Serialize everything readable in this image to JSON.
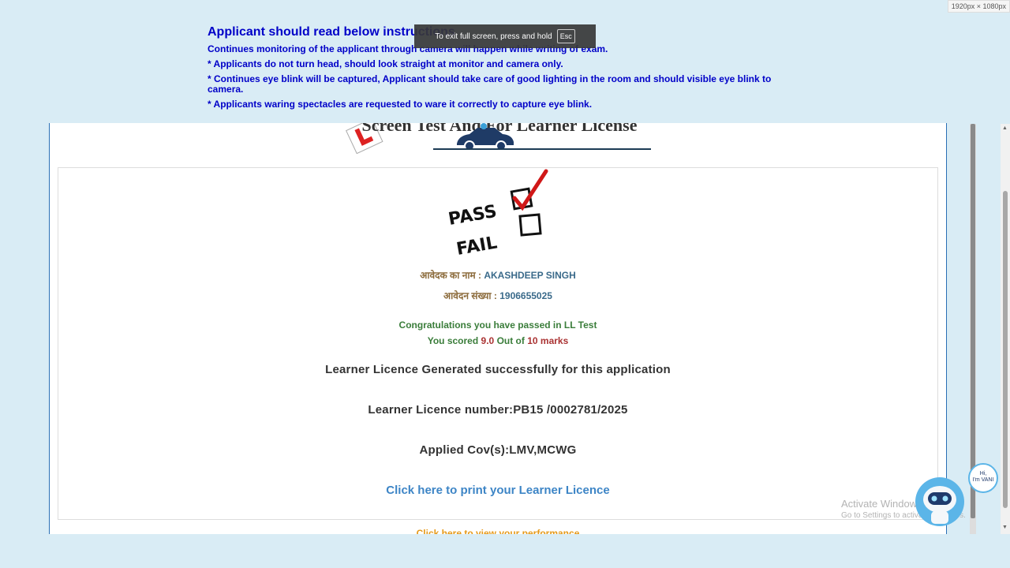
{
  "screen_size_badge": "1920px × 1080px",
  "instructions": {
    "title": "Applicant should read below instructions",
    "lines": [
      "Continues monitoring of the applicant through camera will happen while writing of exam.",
      "* Applicants do not turn head, should look straight at monitor and camera only.",
      "* Continues eye blink will be captured, Applicant should take care of good lighting in the room and should visible eye blink to camera.",
      "* Applicants waring spectacles are requested to ware it correctly to capture eye blink."
    ]
  },
  "fullscreen_toast": {
    "text": "To exit full screen, press and hold",
    "key": "Esc"
  },
  "banner": {
    "title": "Screen Test And For Learner License"
  },
  "result_graphic": {
    "pass": "PASS",
    "fail": "FAIL"
  },
  "applicant": {
    "name_label": "आवेदक का नाम :",
    "name": "AKASHDEEP SINGH",
    "app_no_label": "आवेदन संख्या :",
    "app_no": "1906655025"
  },
  "result": {
    "congrats_text": "Congratulations you have passed in LL Test",
    "scored_prefix": "You scored",
    "score": "9.0",
    "out_of_text": "Out of",
    "total": "10 marks"
  },
  "licence": {
    "generated_text": "Learner Licence Generated successfully for this application",
    "number_text": "Learner Licence number:PB15 /0002781/2025",
    "cov_text": "Applied Cov(s):LMV,MCWG",
    "print_link": "Click here to print your Learner Licence",
    "performance_link": "Click here to view your performance"
  },
  "windows_watermark": {
    "line1": "Activate Windows",
    "line2": "Go to Settings to activate Windows."
  },
  "chatbot": {
    "bubble_line1": "Hi,",
    "bubble_line2": "I'm VANI"
  }
}
